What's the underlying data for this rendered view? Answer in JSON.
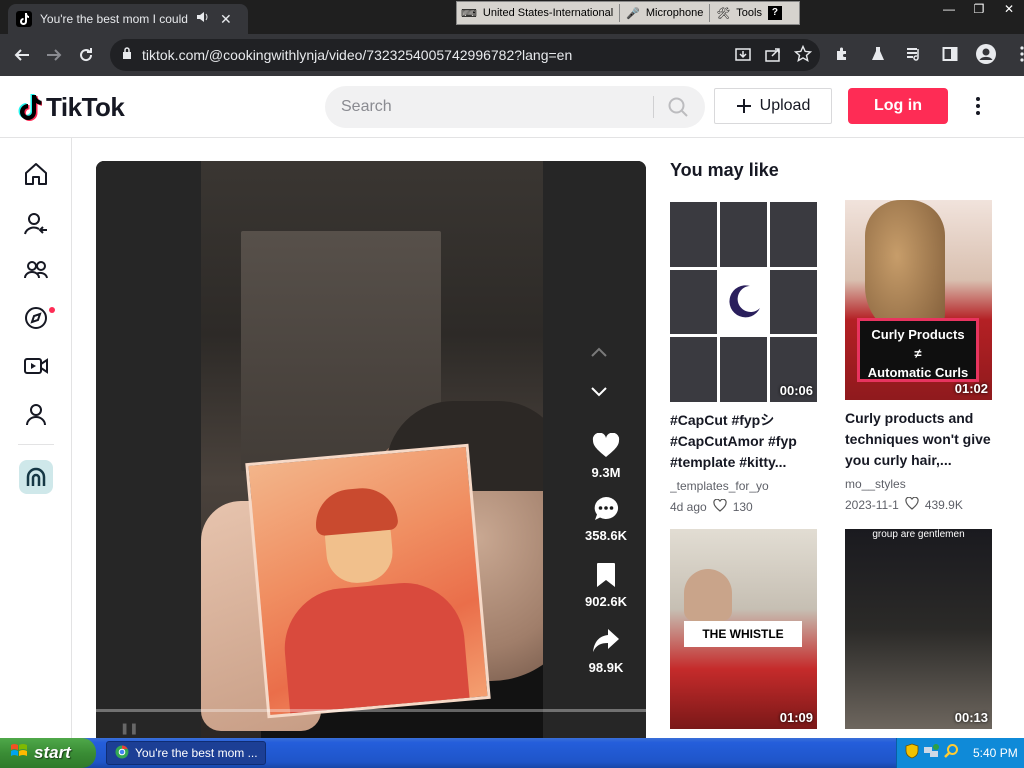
{
  "browser": {
    "tab_title": "You're the best mom I could ha",
    "url": "tiktok.com/@cookingwithlynja/video/7323254005742996782?lang=en"
  },
  "language_bar": {
    "language": "United States-International",
    "microphone": "Microphone",
    "tools": "Tools"
  },
  "header": {
    "brand": "TikTok",
    "search_placeholder": "Search",
    "upload_label": "Upload",
    "login_label": "Log in"
  },
  "player": {
    "likes": "9.3M",
    "comments": "358.6K",
    "saves": "902.6K",
    "shares": "98.9K"
  },
  "recommendations": {
    "title": "You may like",
    "items": [
      {
        "duration": "00:06",
        "description": "#CapCut #fypシ #CapCutAmor #fyp #template #kitty...",
        "author": "_templates_for_yo",
        "date": "4d ago",
        "likes": "130"
      },
      {
        "duration": "01:02",
        "description": "Curly products and techniques won't give you curly hair,...",
        "author": "mo__styles",
        "date": "2023-11-1",
        "likes": "439.9K",
        "overlay_line1": "Curly Products",
        "overlay_line2": "≠",
        "overlay_line3": "Automatic Curls"
      },
      {
        "duration": "01:09",
        "overlay": "THE WHISTLE"
      },
      {
        "duration": "00:13",
        "overlay": "group are gentlemen"
      }
    ]
  },
  "taskbar": {
    "start_label": "start",
    "task_title": "You're the best mom ...",
    "clock": "5:40 PM"
  },
  "colors": {
    "accent": "#fe2c55",
    "text": "#161823",
    "taskbar": "#245edb"
  }
}
